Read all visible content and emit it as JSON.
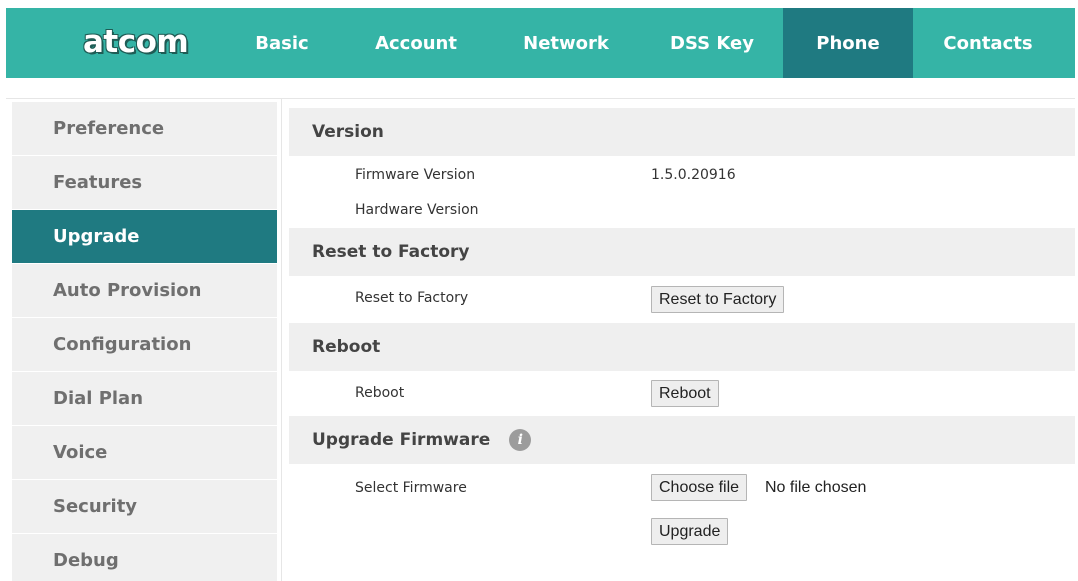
{
  "brand": {
    "logo_text": "atcom"
  },
  "nav": {
    "tabs": [
      {
        "label": "Basic"
      },
      {
        "label": "Account"
      },
      {
        "label": "Network"
      },
      {
        "label": "DSS Key"
      },
      {
        "label": "Phone",
        "active": true
      },
      {
        "label": "Contacts"
      }
    ]
  },
  "sidebar": {
    "items": [
      {
        "label": "Preference"
      },
      {
        "label": "Features"
      },
      {
        "label": "Upgrade",
        "active": true
      },
      {
        "label": "Auto Provision"
      },
      {
        "label": "Configuration"
      },
      {
        "label": "Dial Plan"
      },
      {
        "label": "Voice"
      },
      {
        "label": "Security"
      },
      {
        "label": "Debug"
      }
    ]
  },
  "content": {
    "version": {
      "title": "Version",
      "firmware_label": "Firmware Version",
      "firmware_value": "1.5.0.20916",
      "hardware_label": "Hardware Version",
      "hardware_value": ""
    },
    "reset": {
      "title": "Reset to Factory",
      "label": "Reset to Factory",
      "button": "Reset to Factory"
    },
    "reboot": {
      "title": "Reboot",
      "label": "Reboot",
      "button": "Reboot"
    },
    "upgrade": {
      "title": "Upgrade Firmware",
      "info_icon": "info-icon",
      "select_label": "Select Firmware",
      "choose_button": "Choose file",
      "file_status": "No file chosen",
      "upgrade_button": "Upgrade"
    }
  },
  "colors": {
    "nav_bg": "#35b4a6",
    "active_bg": "#1f7a81",
    "sidebar_bg": "#f0f0f0",
    "section_bg": "#efefef"
  }
}
